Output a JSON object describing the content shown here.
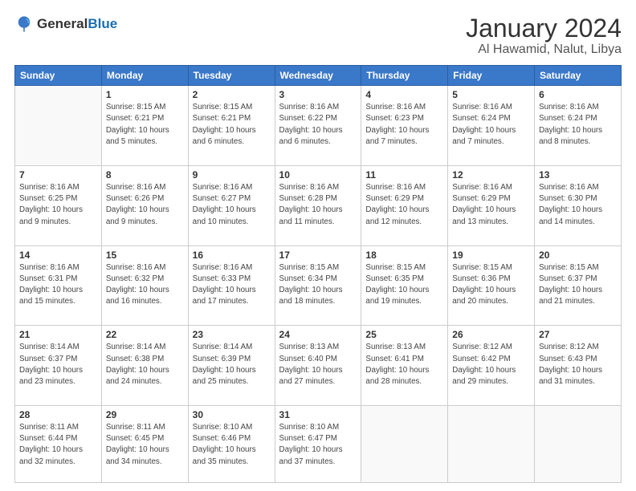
{
  "header": {
    "logo_general": "General",
    "logo_blue": "Blue",
    "title": "January 2024",
    "subtitle": "Al Hawamid, Nalut, Libya"
  },
  "days_of_week": [
    "Sunday",
    "Monday",
    "Tuesday",
    "Wednesday",
    "Thursday",
    "Friday",
    "Saturday"
  ],
  "weeks": [
    [
      {
        "num": "",
        "detail": ""
      },
      {
        "num": "1",
        "detail": "Sunrise: 8:15 AM\nSunset: 6:21 PM\nDaylight: 10 hours\nand 5 minutes."
      },
      {
        "num": "2",
        "detail": "Sunrise: 8:15 AM\nSunset: 6:21 PM\nDaylight: 10 hours\nand 6 minutes."
      },
      {
        "num": "3",
        "detail": "Sunrise: 8:16 AM\nSunset: 6:22 PM\nDaylight: 10 hours\nand 6 minutes."
      },
      {
        "num": "4",
        "detail": "Sunrise: 8:16 AM\nSunset: 6:23 PM\nDaylight: 10 hours\nand 7 minutes."
      },
      {
        "num": "5",
        "detail": "Sunrise: 8:16 AM\nSunset: 6:24 PM\nDaylight: 10 hours\nand 7 minutes."
      },
      {
        "num": "6",
        "detail": "Sunrise: 8:16 AM\nSunset: 6:24 PM\nDaylight: 10 hours\nand 8 minutes."
      }
    ],
    [
      {
        "num": "7",
        "detail": "Sunrise: 8:16 AM\nSunset: 6:25 PM\nDaylight: 10 hours\nand 9 minutes."
      },
      {
        "num": "8",
        "detail": "Sunrise: 8:16 AM\nSunset: 6:26 PM\nDaylight: 10 hours\nand 9 minutes."
      },
      {
        "num": "9",
        "detail": "Sunrise: 8:16 AM\nSunset: 6:27 PM\nDaylight: 10 hours\nand 10 minutes."
      },
      {
        "num": "10",
        "detail": "Sunrise: 8:16 AM\nSunset: 6:28 PM\nDaylight: 10 hours\nand 11 minutes."
      },
      {
        "num": "11",
        "detail": "Sunrise: 8:16 AM\nSunset: 6:29 PM\nDaylight: 10 hours\nand 12 minutes."
      },
      {
        "num": "12",
        "detail": "Sunrise: 8:16 AM\nSunset: 6:29 PM\nDaylight: 10 hours\nand 13 minutes."
      },
      {
        "num": "13",
        "detail": "Sunrise: 8:16 AM\nSunset: 6:30 PM\nDaylight: 10 hours\nand 14 minutes."
      }
    ],
    [
      {
        "num": "14",
        "detail": "Sunrise: 8:16 AM\nSunset: 6:31 PM\nDaylight: 10 hours\nand 15 minutes."
      },
      {
        "num": "15",
        "detail": "Sunrise: 8:16 AM\nSunset: 6:32 PM\nDaylight: 10 hours\nand 16 minutes."
      },
      {
        "num": "16",
        "detail": "Sunrise: 8:16 AM\nSunset: 6:33 PM\nDaylight: 10 hours\nand 17 minutes."
      },
      {
        "num": "17",
        "detail": "Sunrise: 8:15 AM\nSunset: 6:34 PM\nDaylight: 10 hours\nand 18 minutes."
      },
      {
        "num": "18",
        "detail": "Sunrise: 8:15 AM\nSunset: 6:35 PM\nDaylight: 10 hours\nand 19 minutes."
      },
      {
        "num": "19",
        "detail": "Sunrise: 8:15 AM\nSunset: 6:36 PM\nDaylight: 10 hours\nand 20 minutes."
      },
      {
        "num": "20",
        "detail": "Sunrise: 8:15 AM\nSunset: 6:37 PM\nDaylight: 10 hours\nand 21 minutes."
      }
    ],
    [
      {
        "num": "21",
        "detail": "Sunrise: 8:14 AM\nSunset: 6:37 PM\nDaylight: 10 hours\nand 23 minutes."
      },
      {
        "num": "22",
        "detail": "Sunrise: 8:14 AM\nSunset: 6:38 PM\nDaylight: 10 hours\nand 24 minutes."
      },
      {
        "num": "23",
        "detail": "Sunrise: 8:14 AM\nSunset: 6:39 PM\nDaylight: 10 hours\nand 25 minutes."
      },
      {
        "num": "24",
        "detail": "Sunrise: 8:13 AM\nSunset: 6:40 PM\nDaylight: 10 hours\nand 27 minutes."
      },
      {
        "num": "25",
        "detail": "Sunrise: 8:13 AM\nSunset: 6:41 PM\nDaylight: 10 hours\nand 28 minutes."
      },
      {
        "num": "26",
        "detail": "Sunrise: 8:12 AM\nSunset: 6:42 PM\nDaylight: 10 hours\nand 29 minutes."
      },
      {
        "num": "27",
        "detail": "Sunrise: 8:12 AM\nSunset: 6:43 PM\nDaylight: 10 hours\nand 31 minutes."
      }
    ],
    [
      {
        "num": "28",
        "detail": "Sunrise: 8:11 AM\nSunset: 6:44 PM\nDaylight: 10 hours\nand 32 minutes."
      },
      {
        "num": "29",
        "detail": "Sunrise: 8:11 AM\nSunset: 6:45 PM\nDaylight: 10 hours\nand 34 minutes."
      },
      {
        "num": "30",
        "detail": "Sunrise: 8:10 AM\nSunset: 6:46 PM\nDaylight: 10 hours\nand 35 minutes."
      },
      {
        "num": "31",
        "detail": "Sunrise: 8:10 AM\nSunset: 6:47 PM\nDaylight: 10 hours\nand 37 minutes."
      },
      {
        "num": "",
        "detail": ""
      },
      {
        "num": "",
        "detail": ""
      },
      {
        "num": "",
        "detail": ""
      }
    ]
  ]
}
